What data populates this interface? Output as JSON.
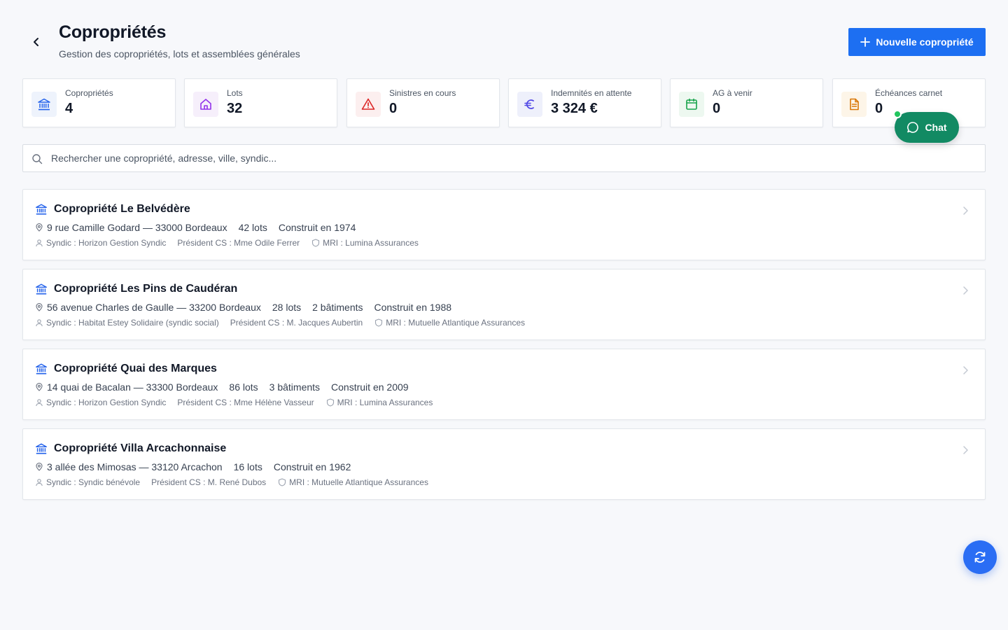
{
  "header": {
    "title": "Copropriétés",
    "subtitle": "Gestion des copropriétés, lots et assemblées générales",
    "new_button": "Nouvelle copropriété"
  },
  "stats": [
    {
      "label": "Copropriétés",
      "value": "4",
      "icon": "building-icon",
      "color": "#2563eb",
      "bg": "#eef3fc"
    },
    {
      "label": "Lots",
      "value": "32",
      "icon": "home-icon",
      "color": "#9333ea",
      "bg": "#f6effb"
    },
    {
      "label": "Sinistres en cours",
      "value": "0",
      "icon": "warning-icon",
      "color": "#dc2626",
      "bg": "#fcefef"
    },
    {
      "label": "Indemnités en attente",
      "value": "3 324 €",
      "icon": "euro-icon",
      "color": "#4f46e5",
      "bg": "#eef0fb"
    },
    {
      "label": "AG à venir",
      "value": "0",
      "icon": "calendar-icon",
      "color": "#16a34a",
      "bg": "#edf8f0"
    },
    {
      "label": "Échéances carnet",
      "value": "0",
      "icon": "document-icon",
      "color": "#d97706",
      "bg": "#fdf5e8"
    }
  ],
  "search": {
    "placeholder": "Rechercher une copropriété, adresse, ville, syndic..."
  },
  "coproprietes": [
    {
      "name": "Copropriété Le Belvédère",
      "address": "9 rue Camille Godard — 33000 Bordeaux",
      "meta": [
        "42 lots",
        "Construit en 1974"
      ],
      "syndic": "Syndic : Horizon Gestion Syndic",
      "president": "Président CS : Mme Odile Ferrer",
      "mri": "MRI : Lumina Assurances"
    },
    {
      "name": "Copropriété Les Pins de Caudéran",
      "address": "56 avenue Charles de Gaulle — 33200 Bordeaux",
      "meta": [
        "28 lots",
        "2 bâtiments",
        "Construit en 1988"
      ],
      "syndic": "Syndic : Habitat Estey Solidaire (syndic social)",
      "president": "Président CS : M. Jacques Aubertin",
      "mri": "MRI : Mutuelle Atlantique Assurances"
    },
    {
      "name": "Copropriété Quai des Marques",
      "address": "14 quai de Bacalan — 33300 Bordeaux",
      "meta": [
        "86 lots",
        "3 bâtiments",
        "Construit en 2009"
      ],
      "syndic": "Syndic : Horizon Gestion Syndic",
      "president": "Président CS : Mme Hélène Vasseur",
      "mri": "MRI : Lumina Assurances"
    },
    {
      "name": "Copropriété Villa Arcachonnaise",
      "address": "3 allée des Mimosas — 33120 Arcachon",
      "meta": [
        "16 lots",
        "Construit en 1962"
      ],
      "syndic": "Syndic : Syndic bénévole",
      "president": "Président CS : M. René Dubos",
      "mri": "MRI : Mutuelle Atlantique Assurances"
    }
  ],
  "chat": {
    "label": "Chat"
  },
  "colors": {
    "primary": "#1d6ff2",
    "chat": "#128a63",
    "online": "#22c55e"
  }
}
